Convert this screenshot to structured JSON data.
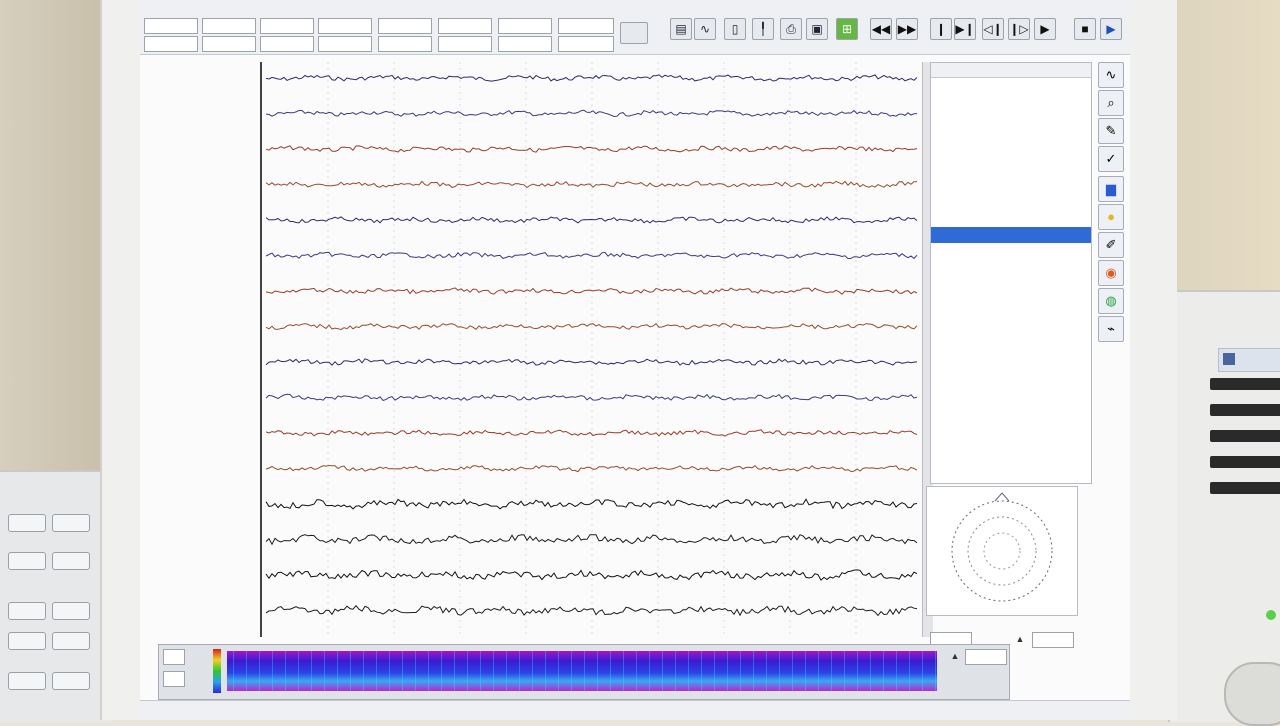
{
  "toolbar": {
    "fields_row1": [
      "",
      "",
      "",
      "",
      "",
      "",
      "",
      ""
    ],
    "fields_row2": [
      "",
      "",
      "",
      "",
      "",
      "",
      "",
      ""
    ],
    "buttons": [
      {
        "name": "display-icon"
      },
      {
        "name": "waveform-icon"
      },
      {
        "name": "document-icon"
      },
      {
        "name": "marker-icon"
      },
      {
        "name": "print-icon"
      },
      {
        "name": "save-icon"
      },
      {
        "name": "montage-icon"
      },
      {
        "name": "rewind-icon"
      },
      {
        "name": "fast-backward-icon"
      },
      {
        "name": "step-back-icon"
      },
      {
        "name": "skip-end-icon"
      },
      {
        "name": "previous-page-icon"
      },
      {
        "name": "next-page-icon"
      },
      {
        "name": "forward-icon"
      },
      {
        "name": "stop-icon"
      },
      {
        "name": "play-icon"
      }
    ]
  },
  "channels": {
    "count": 16,
    "colors": [
      "#2b2b6b",
      "#3a3a80",
      "#9a3b2a",
      "#9a4a2a",
      "#2b2b6b",
      "#3a3a80",
      "#9a3b2a",
      "#9a4a2a",
      "#2b2b6b",
      "#3a3a80",
      "#9a3b2a",
      "#9a4a2a",
      "#111111",
      "#1d1d1d",
      "#111111",
      "#1d1d1d"
    ]
  },
  "side_panel": {
    "rows": 22,
    "selected_index": 8
  },
  "side_buttons": [
    {
      "name": "waveform-icon"
    },
    {
      "name": "zoom-icon"
    },
    {
      "name": "note-icon"
    },
    {
      "name": "check-icon"
    },
    {
      "name": "spectrum-icon"
    },
    {
      "name": "folder-icon"
    },
    {
      "name": "edit-icon"
    },
    {
      "name": "head-map-icon"
    },
    {
      "name": "color-map-icon"
    },
    {
      "name": "graph-icon"
    }
  ],
  "colors": {
    "selection": "#2f6bd6",
    "play_button": "#66b845",
    "spectrogram_low": "#3c1ad0",
    "spectrogram_high": "#a018c8"
  }
}
